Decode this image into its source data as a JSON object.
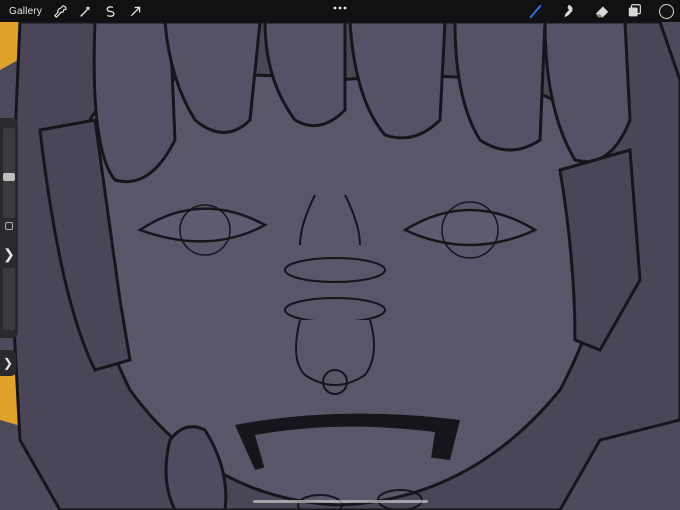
{
  "topbar": {
    "gallery_label": "Gallery",
    "left_tools": [
      "wrench-icon",
      "magic-wand-icon",
      "selection-icon",
      "transform-arrow-icon"
    ],
    "right_tools": [
      "brush-icon",
      "smudge-icon",
      "eraser-icon",
      "layers-icon"
    ],
    "active_tool": "brush-icon",
    "accent": "#2d7cf6",
    "current_color": "#141417"
  },
  "sidebar": {
    "brush_size_level": 0.45,
    "undo_glyph": "❯",
    "redo_glyph": "❯"
  },
  "canvas": {
    "skin": "#5a566a",
    "shadow": "#3f3b4d",
    "highlight": "#7a7690",
    "line": "#16151c",
    "background_yellow": "#e0a22a"
  }
}
